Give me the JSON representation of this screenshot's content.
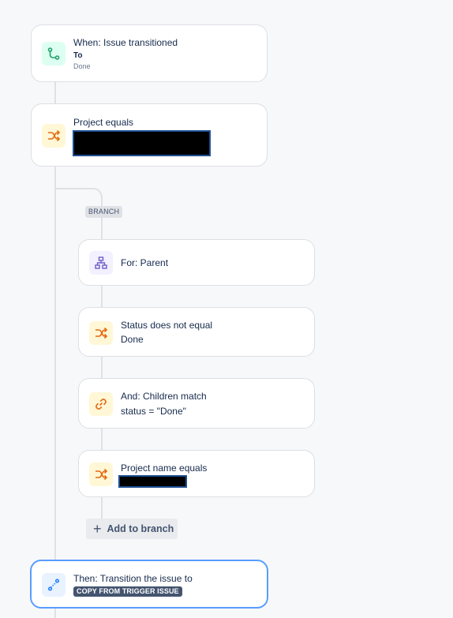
{
  "rule": {
    "trigger": {
      "title": "When: Issue transitioned",
      "to_label": "To",
      "to_value": "Done",
      "icon": "transition-icon",
      "color": "#22a06b"
    },
    "condition_project": {
      "title": "Project equals",
      "icon": "shuffle-icon"
    },
    "branch": {
      "tag": "BRANCH",
      "for": {
        "title": "For: Parent",
        "icon": "hierarchy-icon"
      },
      "status": {
        "title": "Status does not equal",
        "value": "Done",
        "icon": "shuffle-icon"
      },
      "children": {
        "title": "And: Children match",
        "value": "status = \"Done\"",
        "icon": "link-icon"
      },
      "project_name": {
        "title": "Project name equals",
        "icon": "shuffle-icon"
      },
      "add_label": "Add to branch"
    },
    "action": {
      "title": "Then: Transition the issue to",
      "lozenge": "COPY FROM TRIGGER ISSUE",
      "icon": "transition-icon"
    }
  },
  "colors": {
    "accent_orange": "#e56910",
    "accent_green": "#22a06b",
    "accent_purple": "#6e5dc6",
    "accent_blue": "#1d7afc",
    "selected_border": "#579dff"
  }
}
